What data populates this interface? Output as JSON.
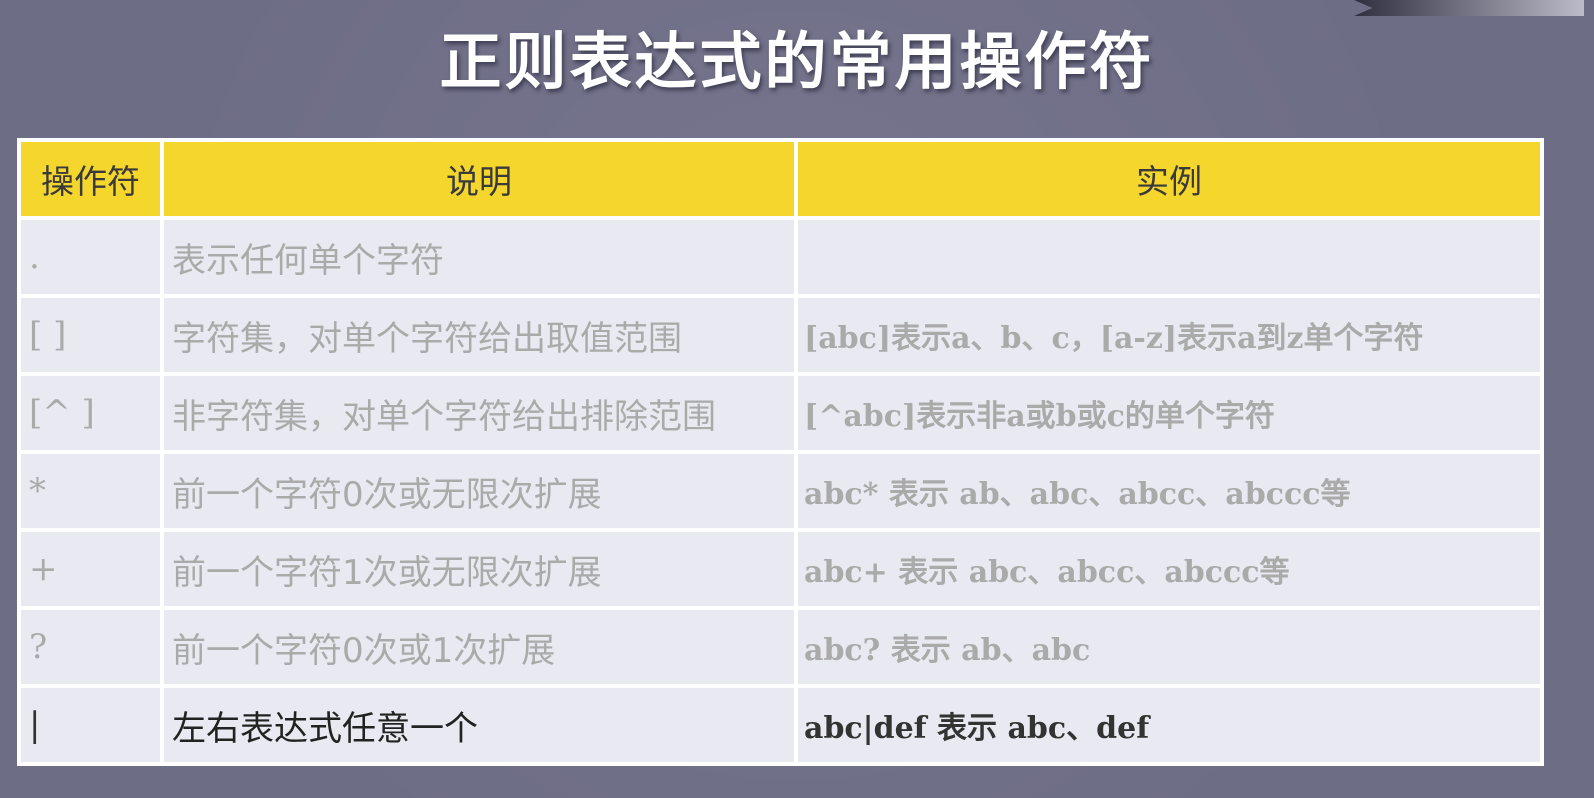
{
  "slide": {
    "title": "正则表达式的常用操作符"
  },
  "table": {
    "headers": {
      "operator": "操作符",
      "description": "说明",
      "example": "实例"
    },
    "rows": [
      {
        "operator": ".",
        "description": "表示任何单个字符",
        "example": ""
      },
      {
        "operator": "[ ]",
        "description": "字符集，对单个字符给出取值范围",
        "example": "[abc]表示a、b、c，[a-z]表示a到z单个字符"
      },
      {
        "operator": "[^ ]",
        "description": "非字符集，对单个字符给出排除范围",
        "example": "[^abc]表示非a或b或c的单个字符"
      },
      {
        "operator": "*",
        "description": "前一个字符0次或无限次扩展",
        "example": "abc* 表示 ab、abc、abcc、abccc等"
      },
      {
        "operator": "+",
        "description": "前一个字符1次或无限次扩展",
        "example": "abc+ 表示 abc、abcc、abccc等"
      },
      {
        "operator": "?",
        "description": "前一个字符0次或1次扩展",
        "example": "abc? 表示 ab、abc"
      },
      {
        "operator": "|",
        "description": "左右表达式任意一个",
        "example": "abc|def 表示 abc、def"
      }
    ]
  },
  "colors": {
    "header_bg": "#f4d62d",
    "row_bg": "#e9eaf1",
    "slide_bg": "#6e6d86",
    "muted_text": "#aaaaaa",
    "active_text": "#333333"
  }
}
